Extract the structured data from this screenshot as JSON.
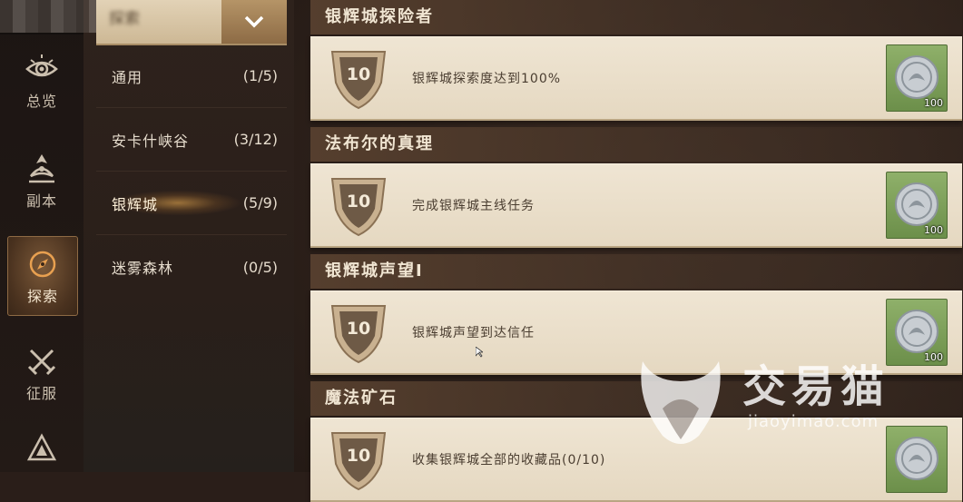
{
  "nav": {
    "items": [
      {
        "label": "总览",
        "icon": "eye-icon"
      },
      {
        "label": "副本",
        "icon": "dungeon-icon"
      },
      {
        "label": "探索",
        "icon": "compass-icon",
        "active": true
      },
      {
        "label": "征服",
        "icon": "crossed-swords-icon"
      },
      {
        "label": "",
        "icon": "pyramid-icon"
      }
    ]
  },
  "dropdown": {
    "label": "探索"
  },
  "categories": [
    {
      "name": "通用",
      "count": "(1/5)"
    },
    {
      "name": "安卡什峡谷",
      "count": "(3/12)"
    },
    {
      "name": "银辉城",
      "count": "(5/9)",
      "active": true
    },
    {
      "name": "迷雾森林",
      "count": "(0/5)"
    }
  ],
  "achievements": [
    {
      "title": "银辉城探险者",
      "points": "10",
      "desc": "银辉城探索度达到100%",
      "reward_qty": "100"
    },
    {
      "title": "法布尔的真理",
      "points": "10",
      "desc": "完成银辉城主线任务",
      "reward_qty": "100"
    },
    {
      "title": "银辉城声望I",
      "points": "10",
      "desc": "银辉城声望到达信任",
      "reward_qty": "100"
    },
    {
      "title": "魔法矿石",
      "points": "10",
      "desc": "收集银辉城全部的收藏品(0/10)",
      "reward_qty": ""
    }
  ],
  "watermark": {
    "text": "交易猫",
    "sub": "jiaoyimao.com"
  },
  "colors": {
    "accent": "#8e6a44",
    "card": "#efe5d3",
    "reward_bg": "#7fa15a"
  }
}
